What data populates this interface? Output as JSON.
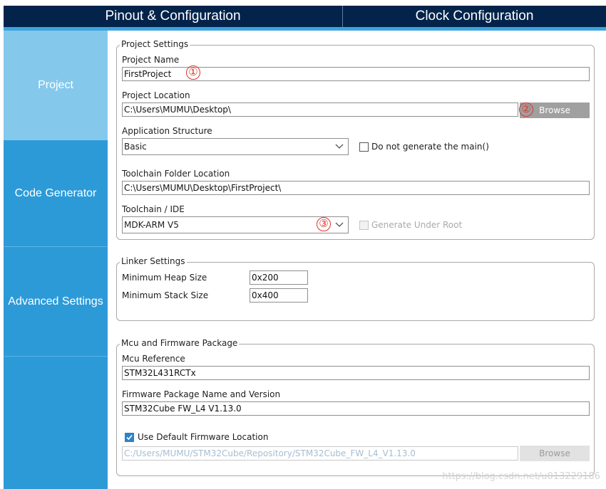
{
  "tabs": {
    "pinout": "Pinout & Configuration",
    "clock": "Clock Configuration"
  },
  "sidebar": {
    "items": [
      {
        "label": "Project",
        "active": true
      },
      {
        "label": "Code Generator",
        "active": false
      },
      {
        "label": "Advanced Settings",
        "active": false
      }
    ]
  },
  "project_settings": {
    "title": "Project Settings",
    "project_name_label": "Project Name",
    "project_name_value": "FirstProject",
    "project_location_label": "Project Location",
    "project_location_value": "C:\\Users\\MUMU\\Desktop\\",
    "browse_label": "Browse",
    "app_structure_label": "Application Structure",
    "app_structure_value": "Basic",
    "no_main_label": "Do not generate the main()",
    "no_main_checked": false,
    "toolchain_folder_label": "Toolchain Folder Location",
    "toolchain_folder_value": "C:\\Users\\MUMU\\Desktop\\FirstProject\\",
    "toolchain_ide_label": "Toolchain / IDE",
    "toolchain_ide_value": "MDK-ARM V5",
    "generate_under_root_label": "Generate Under Root",
    "generate_under_root_enabled": false
  },
  "linker_settings": {
    "title": "Linker Settings",
    "min_heap_label": "Minimum Heap Size",
    "min_heap_value": "0x200",
    "min_stack_label": "Minimum Stack Size",
    "min_stack_value": "0x400"
  },
  "mcu_firmware": {
    "title": "Mcu and Firmware Package",
    "mcu_reference_label": "Mcu Reference",
    "mcu_reference_value": "STM32L431RCTx",
    "firmware_label": "Firmware Package Name and Version",
    "firmware_value": "STM32Cube FW_L4 V1.13.0",
    "use_default_label": "Use Default Firmware Location",
    "use_default_checked": true,
    "firmware_location_value": "C:/Users/MUMU/STM32Cube/Repository/STM32Cube_FW_L4_V1.13.0",
    "browse_label": "Browse"
  },
  "annotations": {
    "marker1": "①",
    "marker2": "②",
    "marker3": "③"
  },
  "watermark": "https://blog.csdn.net/u013229186",
  "colors": {
    "topbar": "#03234b",
    "accent": "#3ea4dc",
    "sidebar": "#2d9ad8",
    "sidebar_active": "#84c9ec",
    "marker": "#d9342b"
  }
}
